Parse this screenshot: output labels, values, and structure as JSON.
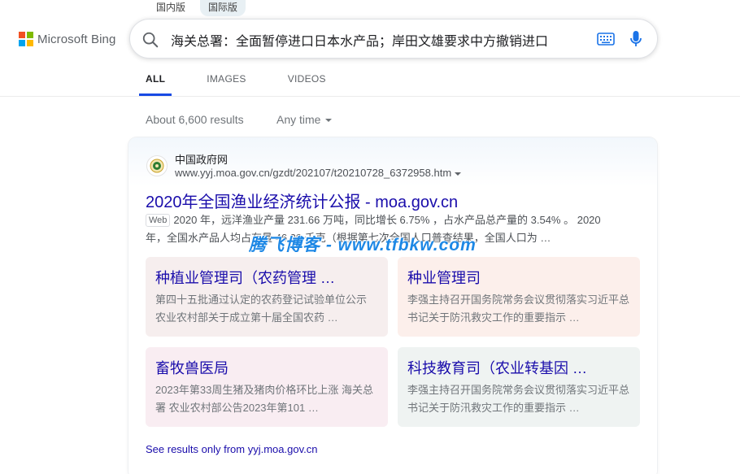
{
  "region_tabs": [
    "国内版",
    "国际版"
  ],
  "region_active_index": 1,
  "logo": {
    "text": "Microsoft Bing",
    "colors": [
      "#f25022",
      "#7fba00",
      "#00a4ef",
      "#ffb900"
    ]
  },
  "search": {
    "query": "海关总署：全面暂停进口日本水产品；岸田文雄要求中方撤销进口",
    "icons": [
      "search-icon",
      "keyboard-icon",
      "microphone-icon"
    ]
  },
  "nav": {
    "tabs": [
      "ALL",
      "IMAGES",
      "VIDEOS"
    ],
    "active_index": 0
  },
  "results_count": "About 6,600 results",
  "time_filter": "Any time",
  "result": {
    "site_name": "中国政府网",
    "url": "www.yyj.moa.gov.cn/gzdt/202107/t20210728_6372958.htm",
    "title": "2020年全国渔业经济统计公报 - moa.gov.cn",
    "web_label": "Web",
    "snippet_line1": "2020 年，远洋渔业产量 231.66 万吨，同比增长 6.75% ，占水产品总产量的 3.54% 。 2020",
    "snippet_line2": "年，全国水产品人均占有量 46.39 千克（根据第七次全国人口普查结果，全国人口为 …"
  },
  "deep_links": [
    {
      "title": "种植业管理司（农药管理 …",
      "desc": "第四十五批通过认定的农药登记试验单位公示 农业农村部关于成立第十届全国农药 …",
      "bg": "#f6eeee"
    },
    {
      "title": "种业管理司",
      "desc": "李强主持召开国务院常务会议贯彻落实习近平总书记关于防汛救灾工作的重要指示 …",
      "bg": "#fcefeb"
    },
    {
      "title": "畜牧兽医局",
      "desc": "2023年第33周生猪及猪肉价格环比上涨 海关总署 农业农村部公告2023年第101 …",
      "bg": "#f9edf2"
    },
    {
      "title": "科技教育司（农业转基因 …",
      "desc": "李强主持召开国务院常务会议贯彻落实习近平总书记关于防汛救灾工作的重要指示 …",
      "bg": "#eff3f2"
    }
  ],
  "see_more": "See results only from yyj.moa.gov.cn",
  "watermark": "腾飞博客 - www.tfbkw.com"
}
